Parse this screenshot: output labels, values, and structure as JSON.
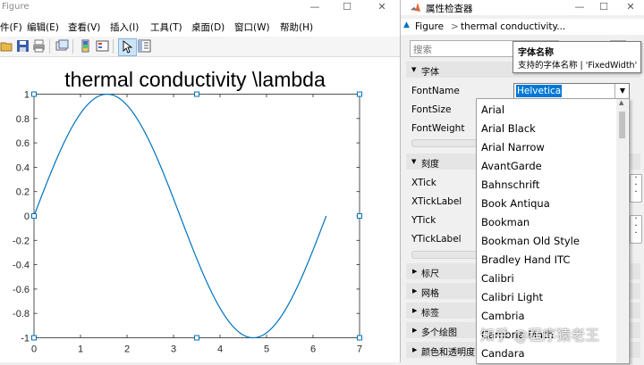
{
  "figure": {
    "title": "Figure",
    "menus": [
      "件(F)",
      "编辑(E)",
      "查看(V)",
      "插入(I)",
      "工具(T)",
      "桌面(D)",
      "窗口(W)",
      "帮助(H)"
    ],
    "plot_title": "thermal conductivity \\lambda"
  },
  "chart_data": {
    "type": "line",
    "title": "thermal conductivity \\lambda",
    "xlabel": "",
    "ylabel": "",
    "xlim": [
      0,
      7
    ],
    "ylim": [
      -1,
      1
    ],
    "xticks": [
      "0",
      "1",
      "2",
      "3",
      "4",
      "5",
      "6",
      "7"
    ],
    "yticks": [
      "-1",
      "-0.8",
      "-0.6",
      "-0.4",
      "-0.2",
      "0",
      "0.2",
      "0.4",
      "0.6",
      "0.8",
      "1"
    ],
    "series": [
      {
        "function": "sin(x)",
        "color": "#0072bd",
        "x": [
          0,
          0.2,
          0.4,
          0.6,
          0.8,
          1.0,
          1.2,
          1.4,
          1.5708,
          1.8,
          2.0,
          2.2,
          2.4,
          2.6,
          2.8,
          3.0,
          3.1416,
          3.4,
          3.6,
          3.8,
          4.0,
          4.2,
          4.4,
          4.7124,
          5.0,
          5.2,
          5.4,
          5.6,
          5.8,
          6.0,
          6.2832
        ],
        "y": [
          0,
          0.199,
          0.389,
          0.565,
          0.717,
          0.841,
          0.932,
          0.985,
          1.0,
          0.974,
          0.909,
          0.808,
          0.675,
          0.516,
          0.335,
          0.141,
          0,
          -0.256,
          -0.443,
          -0.612,
          -0.757,
          -0.872,
          -0.952,
          -1.0,
          -0.959,
          -0.883,
          -0.773,
          -0.631,
          -0.465,
          -0.279,
          0
        ]
      }
    ]
  },
  "inspector": {
    "title": "属性检查器",
    "breadcrumb_root": "Figure",
    "breadcrumb_sep": ">",
    "breadcrumb_current": "thermal conductivity...",
    "search_placeholder": "搜索",
    "sections": {
      "font": "字体",
      "ticks": "刻度",
      "rulers": "标尺",
      "grid": "网格",
      "labels": "标签",
      "multiplot": "多个绘图",
      "color": "颜色和透明度"
    },
    "props": {
      "fontname": "FontName",
      "fontsize": "FontSize",
      "fontweight": "FontWeight",
      "xtick": "XTick",
      "xticklabel": "XTickLabel",
      "ytick": "YTick",
      "yticklabel": "YTickLabel"
    },
    "fontname_value": "Helvetica",
    "tooltip_title": "字体名称",
    "tooltip_body": "支持的字体名称 | 'FixedWidth'",
    "font_options": [
      "Arial",
      "Arial Black",
      "Arial Narrow",
      "AvantGarde",
      "Bahnschrift",
      "Book Antiqua",
      "Bookman",
      "Bookman Old Style",
      "Bradley Hand ITC",
      "Calibri",
      "Calibri Light",
      "Cambria",
      "Cambria Math",
      "Candara"
    ]
  },
  "watermark": "知乎 @程序猿老王",
  "colors": {
    "accent": "#0078d7",
    "line": "#0072bd",
    "matlab": "#e16737"
  }
}
